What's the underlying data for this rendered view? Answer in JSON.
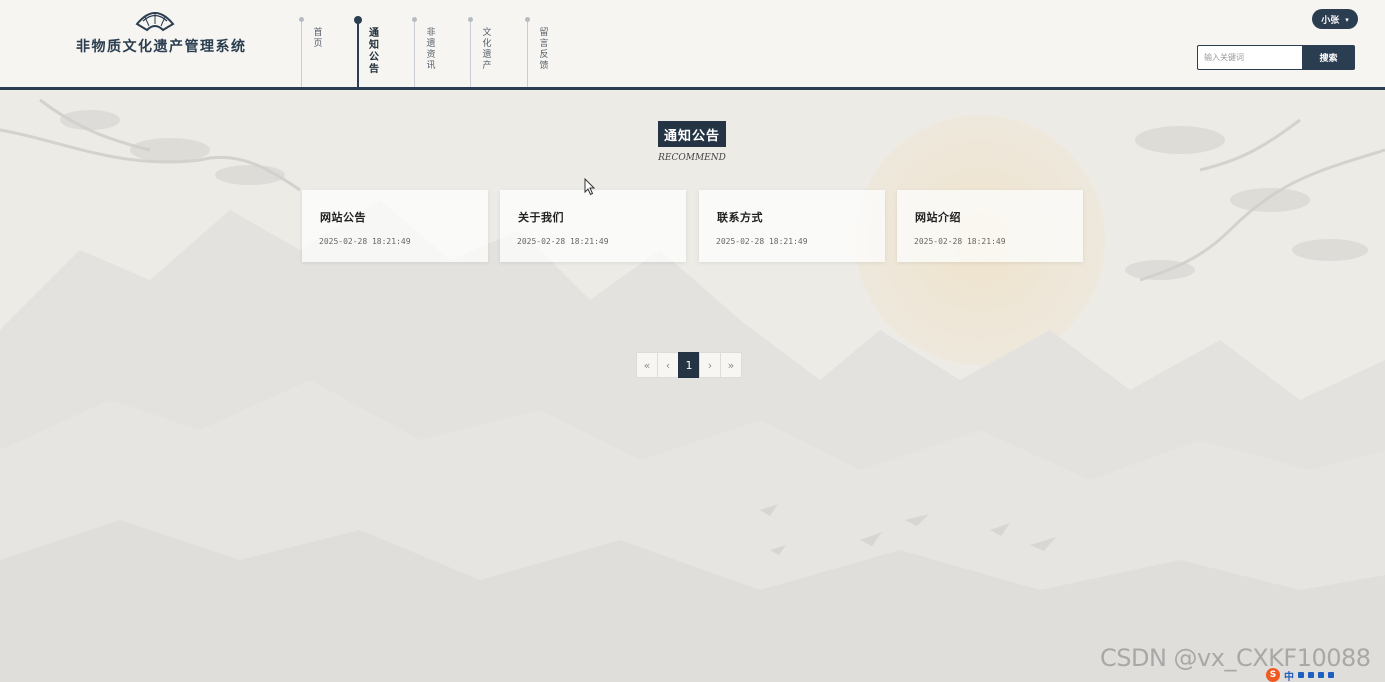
{
  "header": {
    "site_title": "非物质文化遗产管理系统",
    "logo_icon": "fan-icon",
    "nav": [
      {
        "label": "首页",
        "active": false
      },
      {
        "label": "通知公告",
        "active": true
      },
      {
        "label": "非遗资讯",
        "active": false
      },
      {
        "label": "文化遗产",
        "active": false
      },
      {
        "label": "留言反馈",
        "active": false
      }
    ],
    "user": {
      "name": "小张",
      "caret_icon": "caret-down-icon"
    },
    "search": {
      "placeholder": "输入关键词",
      "button_label": "搜索"
    }
  },
  "section": {
    "title": "通知公告",
    "subtitle": "RECOMMEND"
  },
  "cards": [
    {
      "title": "网站公告",
      "date": "2025-02-28 18:21:49"
    },
    {
      "title": "关于我们",
      "date": "2025-02-28 18:21:49"
    },
    {
      "title": "联系方式",
      "date": "2025-02-28 18:21:49"
    },
    {
      "title": "网站介绍",
      "date": "2025-02-28 18:21:49"
    }
  ],
  "pagination": {
    "first": "«",
    "prev": "‹",
    "current": "1",
    "next": "›",
    "last": "»"
  },
  "watermark": "CSDN @vx_CXKF10088",
  "ime": {
    "logo": "S",
    "label": "中"
  },
  "colors": {
    "primary": "#243444",
    "background": "#eceae5",
    "header": "#f6f5f1"
  }
}
